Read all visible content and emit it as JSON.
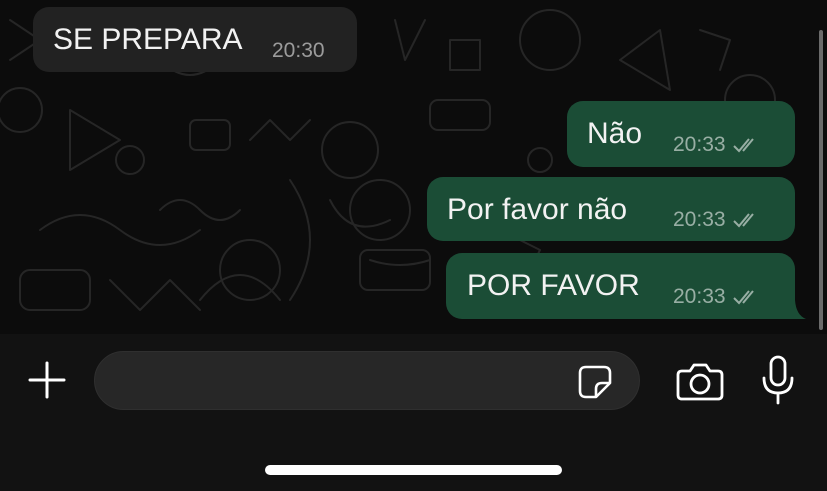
{
  "messages": [
    {
      "direction": "incoming",
      "text": "SE PREPARA",
      "time": "20:30"
    },
    {
      "direction": "outgoing",
      "text": "Não",
      "time": "20:33",
      "status": "read-double-check"
    },
    {
      "direction": "outgoing",
      "text": "Por favor não",
      "time": "20:33",
      "status": "read-double-check"
    },
    {
      "direction": "outgoing",
      "text": "POR FAVOR",
      "time": "20:33",
      "status": "read-double-check"
    }
  ],
  "composer": {
    "placeholder": "",
    "value": "",
    "icons": [
      "plus-icon",
      "sticker-icon",
      "camera-icon",
      "microphone-icon"
    ]
  },
  "colors": {
    "background": "#0c0c0c",
    "incoming_bubble": "#222222",
    "outgoing_bubble": "#1b4d36",
    "composer_bar": "#121212",
    "input_field": "#272727"
  }
}
